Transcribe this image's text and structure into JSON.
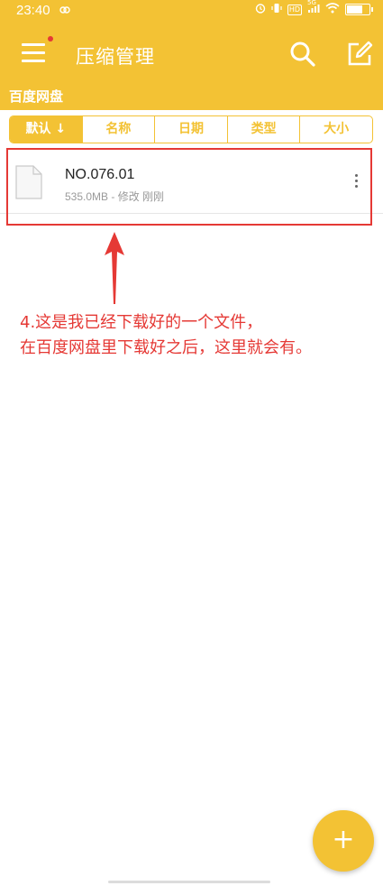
{
  "status_bar": {
    "time": "23:40",
    "network": "5G",
    "hd": "HD"
  },
  "app_bar": {
    "title": "压缩管理",
    "menu_icon": "menu-icon",
    "search_icon": "search-icon",
    "edit_icon": "edit-icon",
    "notification_dot_color": "#E53935"
  },
  "breadcrumb": {
    "path": "百度网盘"
  },
  "sort_tabs": [
    {
      "label": "默认 ↓",
      "active": true
    },
    {
      "label": "名称",
      "active": false
    },
    {
      "label": "日期",
      "active": false
    },
    {
      "label": "类型",
      "active": false
    },
    {
      "label": "大小",
      "active": false
    }
  ],
  "files": [
    {
      "name": "NO.076.01",
      "meta": "535.0MB - 修改 刚刚",
      "icon": "file-icon"
    }
  ],
  "annotation": {
    "line1": "4.这是我已经下载好的一个文件，",
    "line2": "在百度网盘里下载好之后，这里就会有。"
  },
  "fab": {
    "label": "+"
  },
  "colors": {
    "accent": "#F3C234",
    "annotation": "#E53935"
  }
}
